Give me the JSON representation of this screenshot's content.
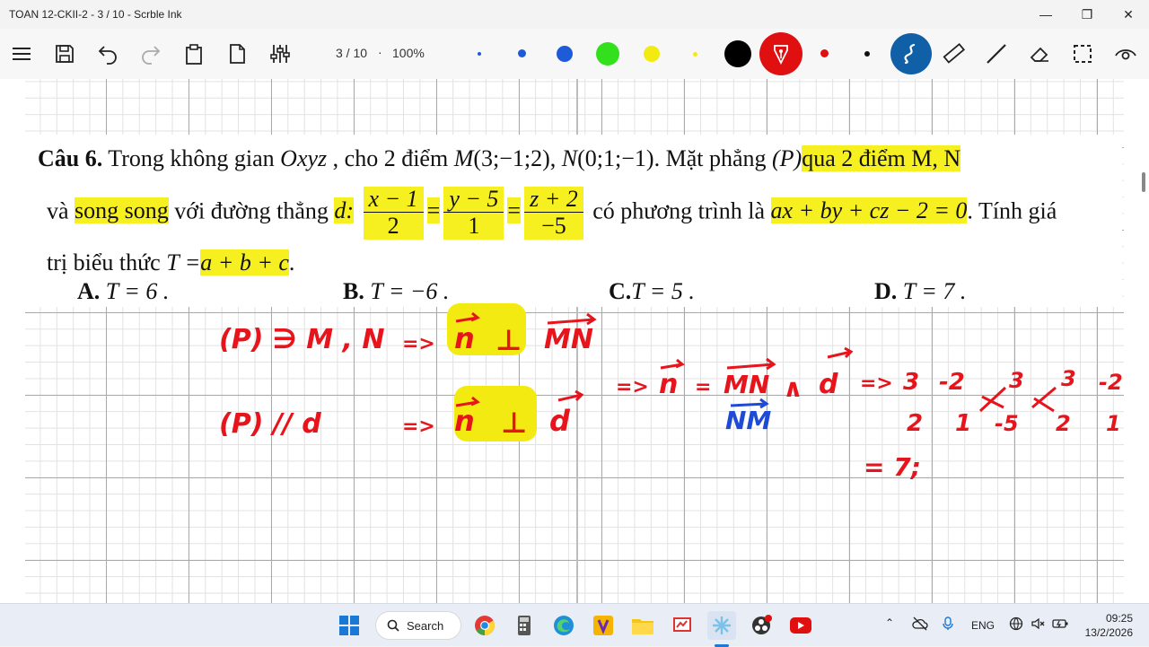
{
  "window": {
    "title": "TOAN 12-CKII-2 - 3 / 10 - Scrble Ink"
  },
  "toolbar": {
    "page_info": "3 / 10",
    "separator": "·",
    "zoom": "100%",
    "pen_colors": [
      "#1e5bd8",
      "#1e5bd8",
      "#1e5bd8",
      "#33e01c",
      "#f3ea12",
      "#f3ea12",
      "#000000",
      "#e01010",
      "#e01010",
      "#111111"
    ]
  },
  "question": {
    "line1_label": "Câu 6.",
    "line1_a": " Trong không gian ",
    "line1_oxyz": "Oxyz",
    "line1_b": " , cho 2 điểm ",
    "line1_M": "M",
    "line1_Mc": "(3;−1;2)",
    "line1_c": ",  ",
    "line1_N": "N",
    "line1_Nc": "(0;1;−1)",
    "line1_d": ". Mặt phẳng ",
    "line1_P": "(P)",
    "line1_hl": "qua 2 điểm M, N",
    "line2_a": "và ",
    "line2_hl": "song song",
    "line2_b": " với đường thẳng ",
    "line2_d": "d:",
    "frac1_num": "x − 1",
    "frac1_den": "2",
    "frac2_num": "y − 5",
    "frac2_den": "1",
    "frac3_num": "z + 2",
    "frac3_den": "−5",
    "eq": "=",
    "line2_c": " có phương trình là ",
    "line2_plane": "ax + by + cz − 2 = 0",
    "line2_e": ". Tính giá",
    "line3_a": "trị  biểu thức ",
    "line3_T": "T =",
    "line3_hl": "a + b + c",
    "line3_end": "."
  },
  "options": {
    "A_label": "A.",
    "A_text": " T = 6 .",
    "B_label": "B.",
    "B_text": " T = −6 .",
    "C_label": "C.",
    "C_text": "T = 5  .",
    "D_label": "D.",
    "D_text": " T = 7 ."
  },
  "handwriting": {
    "l1_left": "(P) ∋ M , N",
    "l1_arrow": "=>",
    "l1_n": "n",
    "l1_perp": "⊥",
    "l1_mn": "MN",
    "l2_left": "(P) // d",
    "l2_arrow": "=>",
    "l2_n": "n",
    "l2_perp": "⊥",
    "l2_d": "d",
    "r1_arrow": "=>",
    "r1_n": "n",
    "r1_eq": "=",
    "r1_mn": "MN",
    "r1_wedge": "∧",
    "r1_d": "d",
    "r1_arrow2": "=>",
    "m_a": "3",
    "m_b": "-2",
    "m_c": "3",
    "m_d": "3",
    "m_e": "-2",
    "m_f": "2",
    "m_g": "1",
    "m_h": "-5",
    "m_i": "2",
    "m_j": "1",
    "blue_nm": "NM",
    "result": "= 7;"
  },
  "taskbar": {
    "search_label": "Search",
    "lang": "ENG",
    "time": "09:25",
    "date": "13/2/2026"
  }
}
